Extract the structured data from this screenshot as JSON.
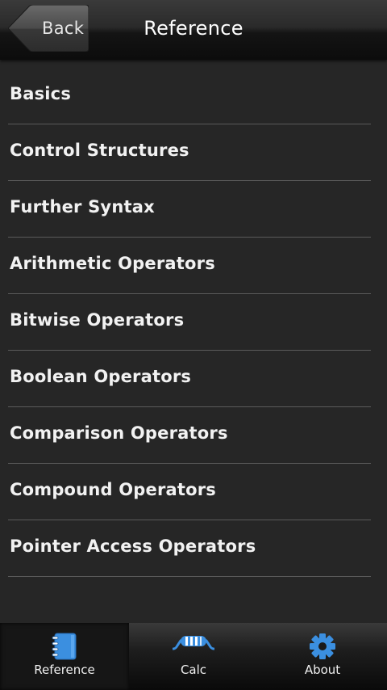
{
  "header": {
    "back_label": "Back",
    "title": "Reference"
  },
  "list": {
    "items": [
      {
        "label": "Basics"
      },
      {
        "label": "Control Structures"
      },
      {
        "label": "Further Syntax"
      },
      {
        "label": "Arithmetic Operators"
      },
      {
        "label": "Bitwise Operators"
      },
      {
        "label": "Boolean Operators"
      },
      {
        "label": "Comparison Operators"
      },
      {
        "label": "Compound Operators"
      },
      {
        "label": "Pointer Access Operators"
      }
    ]
  },
  "bottom_nav": {
    "items": [
      {
        "label": "Reference",
        "icon": "notebook-icon",
        "active": true
      },
      {
        "label": "Calc",
        "icon": "resistor-icon",
        "active": false
      },
      {
        "label": "About",
        "icon": "gear-icon",
        "active": false
      }
    ]
  },
  "colors": {
    "background": "#262626",
    "accent_blue": "#3b8fe0",
    "divider": "#5a5a5a"
  }
}
